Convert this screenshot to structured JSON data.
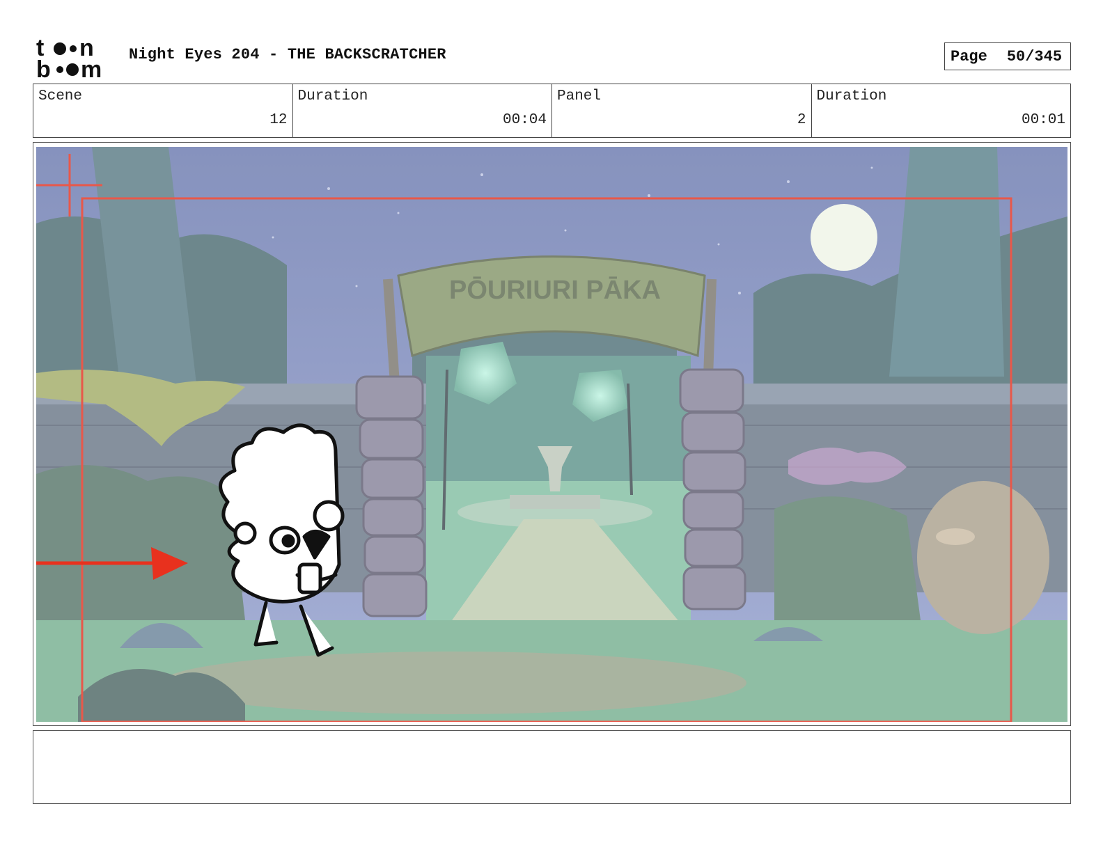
{
  "header": {
    "title": "Night Eyes 204 - THE BACKSCRATCHER",
    "page_label": "Page",
    "page_value": "50/345"
  },
  "info": {
    "scene_label": "Scene",
    "scene_value": "12",
    "scene_duration_label": "Duration",
    "scene_duration_value": "00:04",
    "panel_label": "Panel",
    "panel_value": "2",
    "panel_duration_label": "Duration",
    "panel_duration_value": "00:01"
  },
  "artwork": {
    "sign_text": "PŌURIURI PĀKA"
  },
  "colors": {
    "camera_frame": "#e8584a",
    "action_arrow": "#e8311e",
    "sky": "#6a79b4",
    "grass": "#6ab893"
  }
}
